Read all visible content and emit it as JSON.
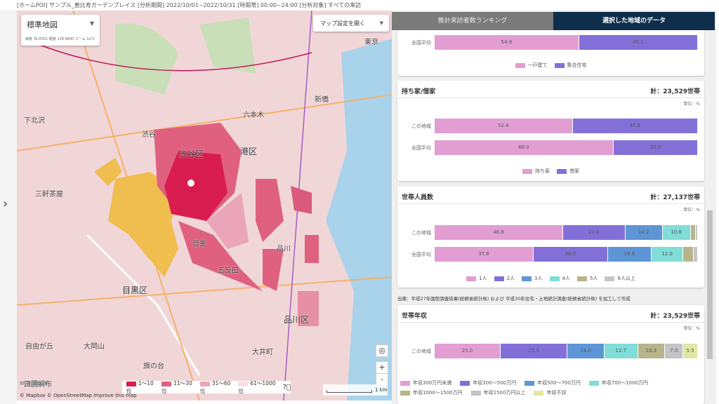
{
  "header": "[ホームPOI] サンプル_恵比寿ガーデンプレイス [分析期間] 2022/10/01~2022/10/31 [時間帯] 00:00~24:00 [分析対象] すべての来訪",
  "map": {
    "style_select": "標準地図",
    "coords": "緯度 35.6551  経度 139.6840  ズーム 12.5",
    "settings_button": "マップ設定を開く",
    "zoom_in": "+",
    "zoom_out": "-",
    "labels": [
      "渋谷区",
      "港区",
      "品川区",
      "目黒区",
      "渋谷",
      "六本木",
      "下北沢",
      "三軒茶屋",
      "自由が丘",
      "大岡山",
      "五反田",
      "品川",
      "大井町",
      "新橋",
      "目黒",
      "旗の台",
      "東京",
      "田園調布"
    ],
    "legend": [
      {
        "label": "1～10位",
        "color": "#d91c4f"
      },
      {
        "label": "11～30位",
        "color": "#e06080"
      },
      {
        "label": "31～60位",
        "color": "#eaa6b8"
      },
      {
        "label": "61～1000位",
        "color": "#f6dde3"
      }
    ],
    "scale": "1 km",
    "attribution": "© Mapbox © OpenStreetMap  Improve this map",
    "logo": "mapbox"
  },
  "tabs": [
    {
      "label": "推計来訪者数ランキング"
    },
    {
      "label": "選択した地域のデータ"
    }
  ],
  "unit": "単位：%",
  "cards": {
    "housing": {
      "row_label": "全国平均",
      "values": [
        54.9,
        45.1
      ],
      "legend": [
        "一戸建て",
        "集合住宅"
      ]
    },
    "ownership": {
      "title": "持ち家/借家",
      "total": "計：23,529世帯",
      "rows": [
        {
          "label": "この地域",
          "values": [
            52.4,
            47.6
          ]
        },
        {
          "label": "全国平均",
          "values": [
            68.0,
            32.0
          ]
        }
      ],
      "legend": [
        "持ち家",
        "借家"
      ]
    },
    "members": {
      "title": "世帯人員数",
      "total": "計：27,137世帯",
      "rows": [
        {
          "label": "この地域",
          "values": [
            48.8,
            23.6,
            14.2,
            10.6,
            2.1,
            0.7
          ]
        },
        {
          "label": "全国平均",
          "values": [
            37.6,
            28.2,
            16.6,
            12.0,
            3.9,
            1.7
          ]
        }
      ],
      "legend": [
        "1人",
        "2人",
        "3人",
        "4人",
        "5人",
        "6人以上"
      ]
    },
    "income": {
      "title": "世帯年収",
      "total": "計：23,529世帯",
      "rows": [
        {
          "label": "この地域",
          "values": [
            25.0,
            25.5,
            14.0,
            12.7,
            10.3,
            7.0,
            5.5
          ]
        }
      ],
      "legend": [
        "年収300万円未満",
        "年収300～500万円",
        "年収500～700万円",
        "年収700～1000万円",
        "年収1000～1500万円",
        "年収1500万円以上",
        "年収不詳"
      ]
    }
  },
  "source": "出典：平成27年国勢調査結果(総務省統計局) および 平成30年住宅・土地統計調査(総務省統計局) を加工して作成",
  "colors": {
    "c1": "#e29ed3",
    "c2": "#8270d8",
    "c3": "#5e95d6",
    "c4": "#80ddd8",
    "c5": "#b7b48c",
    "c6": "#c4c4c4",
    "c7": "#e2e6a4"
  }
}
